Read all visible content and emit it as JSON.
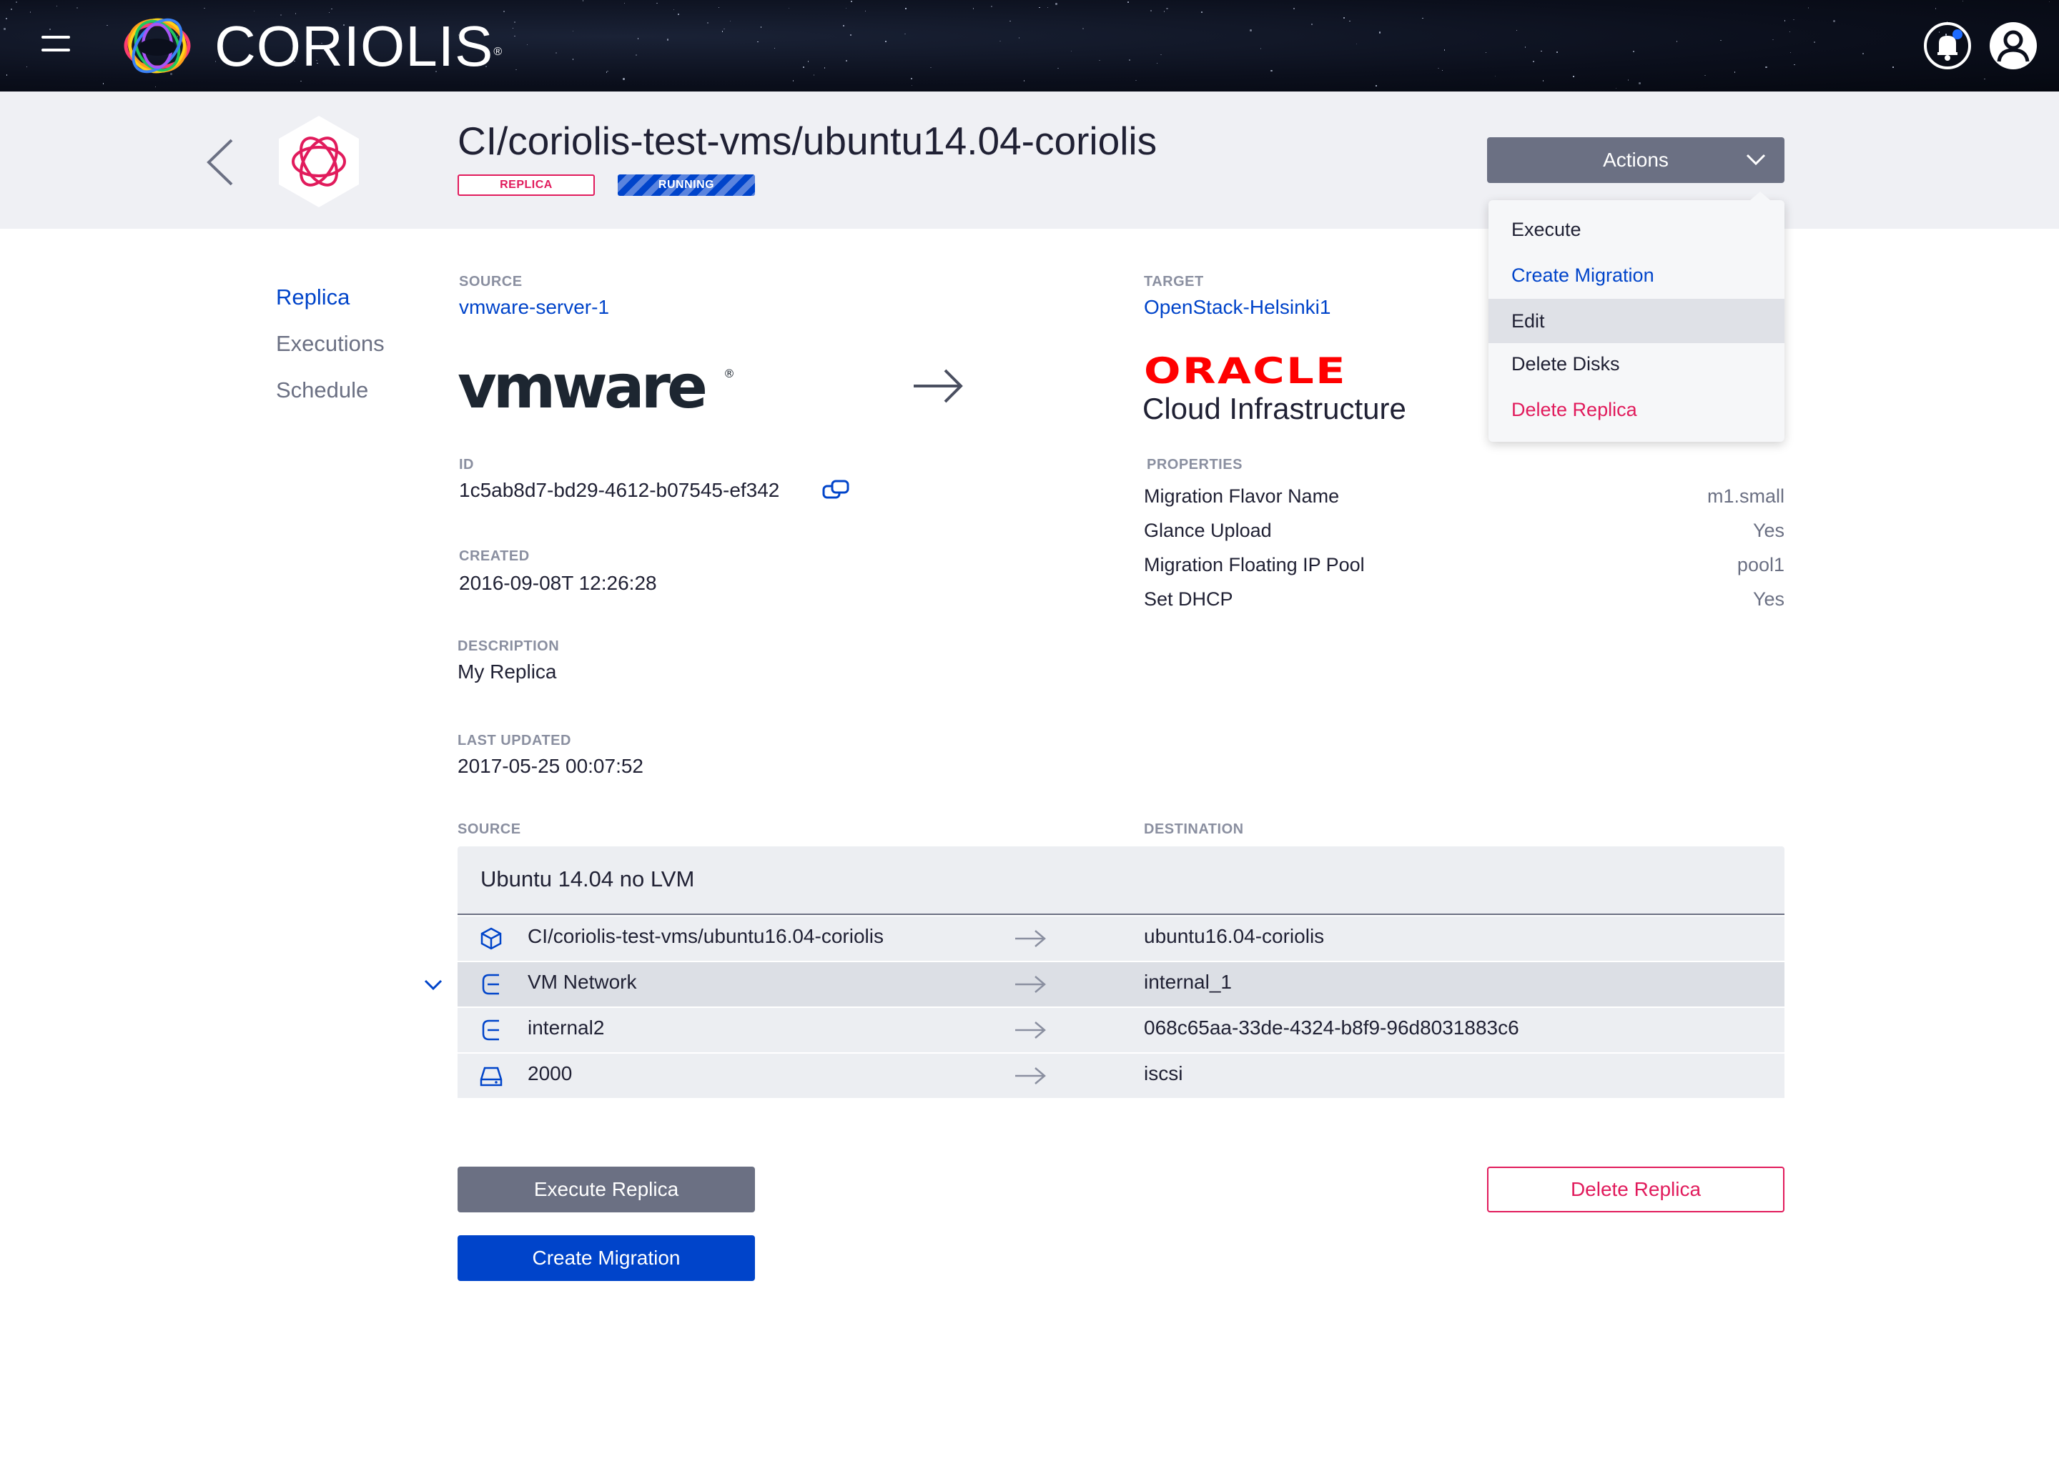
{
  "topbar": {
    "brand": "CORIOLIS",
    "brand_mark": "®",
    "icons": [
      "menu-icon",
      "coriolis-logo",
      "notification-bell-icon",
      "user-avatar-icon"
    ]
  },
  "header": {
    "title": "CI/coriolis-test-vms/ubuntu14.04-coriolis",
    "badges": {
      "type": "REPLICA",
      "status": "RUNNING"
    },
    "actions_label": "Actions"
  },
  "actions_menu": {
    "items": [
      {
        "label": "Execute",
        "color": "default"
      },
      {
        "label": "Create Migration",
        "color": "blue"
      },
      {
        "label": "Edit",
        "color": "default",
        "hovered": true
      },
      {
        "label": "Delete Disks",
        "color": "default"
      },
      {
        "label": "Delete Replica",
        "color": "red"
      }
    ]
  },
  "nav": {
    "items": [
      {
        "label": "Replica",
        "active": true
      },
      {
        "label": "Executions",
        "active": false
      },
      {
        "label": "Schedule",
        "active": false
      }
    ]
  },
  "details": {
    "source_label": "SOURCE",
    "source_value": "vmware-server-1",
    "target_label": "TARGET",
    "target_value": "OpenStack-Helsinki1",
    "source_logo": "vmware",
    "target_logo": "ORACLE",
    "target_logo_sub": "Cloud Infrastructure",
    "id_label": "ID",
    "id_value": "1c5ab8d7-bd29-4612-b07545-ef342",
    "created_label": "CREATED",
    "created_value": "2016-09-08T 12:26:28",
    "description_label": "DESCRIPTION",
    "description_value": "My Replica",
    "updated_label": "LAST UPDATED",
    "updated_value": "2017-05-25 00:07:52",
    "properties_label": "PROPERTIES",
    "properties": [
      {
        "name": "Migration Flavor Name",
        "value": "m1.small"
      },
      {
        "name": "Glance Upload",
        "value": "Yes"
      },
      {
        "name": "Migration Floating IP Pool",
        "value": "pool1"
      },
      {
        "name": "Set DHCP",
        "value": "Yes"
      }
    ]
  },
  "mapping": {
    "source_label": "SOURCE",
    "destination_label": "DESTINATION",
    "vm_name": "Ubuntu 14.04 no LVM",
    "rows": [
      {
        "icon": "instance-cube-icon",
        "source": "CI/coriolis-test-vms/ubuntu16.04-coriolis",
        "destination": "ubuntu16.04-coriolis"
      },
      {
        "icon": "network-icon",
        "source": "VM Network",
        "destination": "internal_1"
      },
      {
        "icon": "network-icon",
        "source": "internal2",
        "destination": "068c65aa-33de-4324-b8f9-96d8031883c6"
      },
      {
        "icon": "storage-drive-icon",
        "source": "2000",
        "destination": "iscsi"
      }
    ]
  },
  "buttons": {
    "execute": "Execute Replica",
    "create_migration": "Create Migration",
    "delete": "Delete Replica"
  },
  "colors": {
    "accent_blue": "#0044ca",
    "danger_red": "#e11b5c",
    "grey": "#6b7083",
    "header_bg": "#eff0f4"
  }
}
